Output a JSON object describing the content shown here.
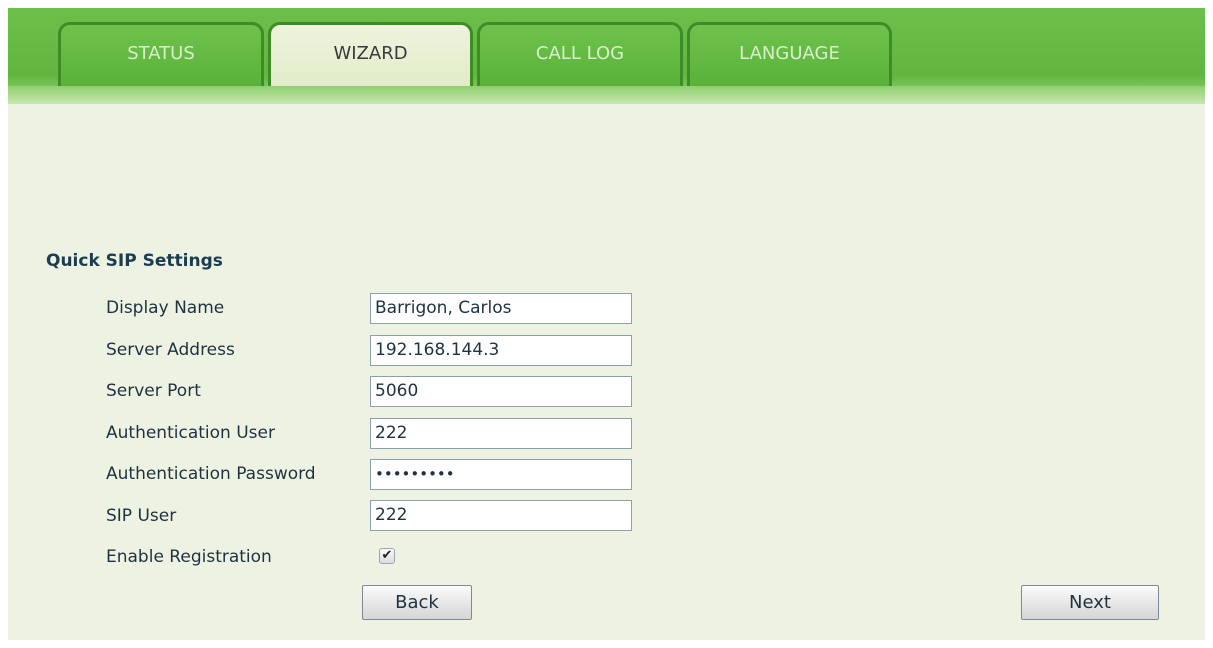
{
  "tabs": [
    {
      "label": "STATUS",
      "active": false
    },
    {
      "label": "WIZARD",
      "active": true
    },
    {
      "label": "CALL LOG",
      "active": false
    },
    {
      "label": "LANGUAGE",
      "active": false
    }
  ],
  "section": {
    "title": "Quick SIP Settings"
  },
  "form": {
    "display_name": {
      "label": "Display Name",
      "value": "Barrigon, Carlos"
    },
    "server_address": {
      "label": "Server Address",
      "value": "192.168.144.3"
    },
    "server_port": {
      "label": "Server Port",
      "value": "5060"
    },
    "auth_user": {
      "label": "Authentication User",
      "value": "222"
    },
    "auth_password": {
      "label": "Authentication Password",
      "value": "•••••••••"
    },
    "sip_user": {
      "label": "SIP User",
      "value": "222"
    },
    "enable_registration": {
      "label": "Enable Registration",
      "checked": true,
      "mark": "✔"
    }
  },
  "buttons": {
    "back": "Back",
    "next": "Next"
  },
  "colors": {
    "tab_green": "#5ab23a",
    "title": "#1c3c50",
    "background": "#eef2e2"
  }
}
